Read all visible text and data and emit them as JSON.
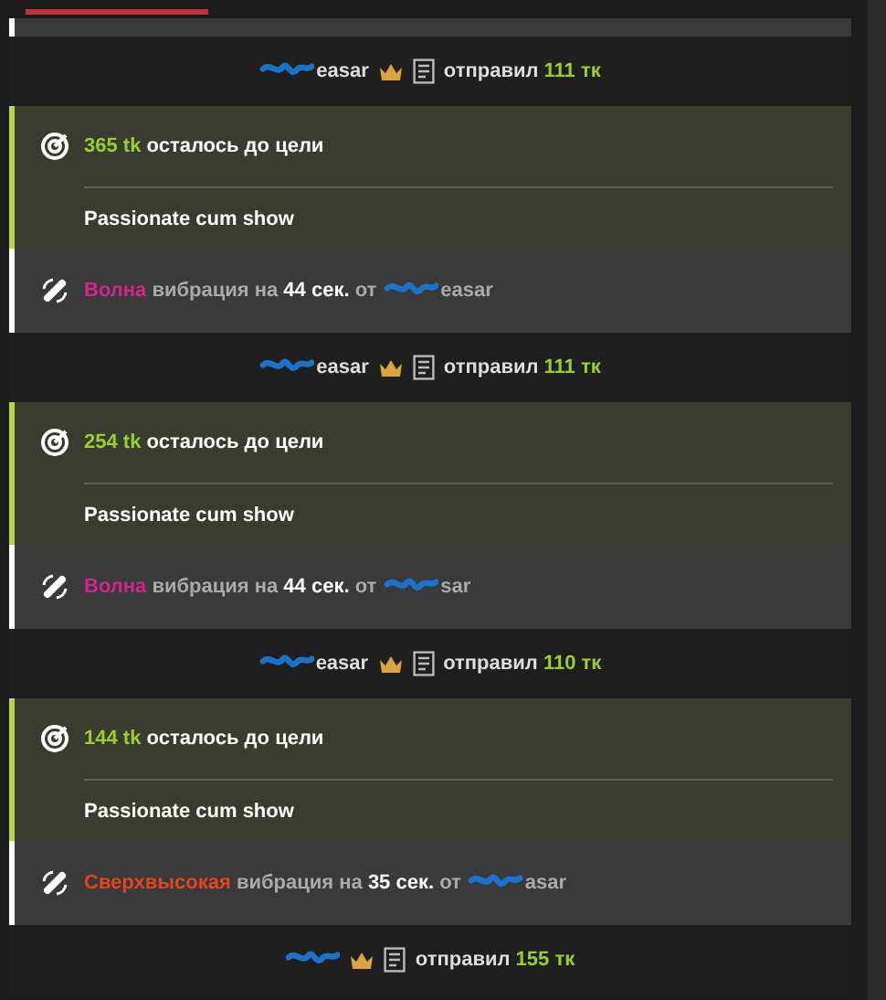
{
  "tabs": [
    {
      "selected": true
    }
  ],
  "events": [
    {
      "kind": "tip",
      "user": "easar",
      "redacted": true,
      "verb": "отправил",
      "amount": "111 тк"
    },
    {
      "kind": "goal",
      "remaining": "365 tk",
      "text": "осталось до цели",
      "goal": "Passionate cum show"
    },
    {
      "kind": "vibration",
      "level_name": "Волна",
      "color": "#d0268a",
      "text": "вибрация на",
      "duration": "44 сек.",
      "from": "от",
      "user": "easar",
      "redacted": true
    },
    {
      "kind": "tip",
      "user": "easar",
      "redacted": true,
      "verb": "отправил",
      "amount": "111 тк"
    },
    {
      "kind": "goal",
      "remaining": "254 tk",
      "text": "осталось до цели",
      "goal": "Passionate cum show"
    },
    {
      "kind": "vibration",
      "level_name": "Волна",
      "color": "#d0268a",
      "text": "вибрация на",
      "duration": "44 сек.",
      "from": "от",
      "user": "sar",
      "redacted": true
    },
    {
      "kind": "tip",
      "user": "easar",
      "redacted": true,
      "verb": "отправил",
      "amount": "110 тк"
    },
    {
      "kind": "goal",
      "remaining": "144 tk",
      "text": "осталось до цели",
      "goal": "Passionate cum show"
    },
    {
      "kind": "vibration",
      "level_name": "Сверхвысокая",
      "color": "#e0451f",
      "text": "вибрация на",
      "duration": "35 сек.",
      "from": "от",
      "user": "asar",
      "redacted": true
    },
    {
      "kind": "tip",
      "redacted": true,
      "verb": "отправил",
      "amount": "155 тк"
    }
  ]
}
